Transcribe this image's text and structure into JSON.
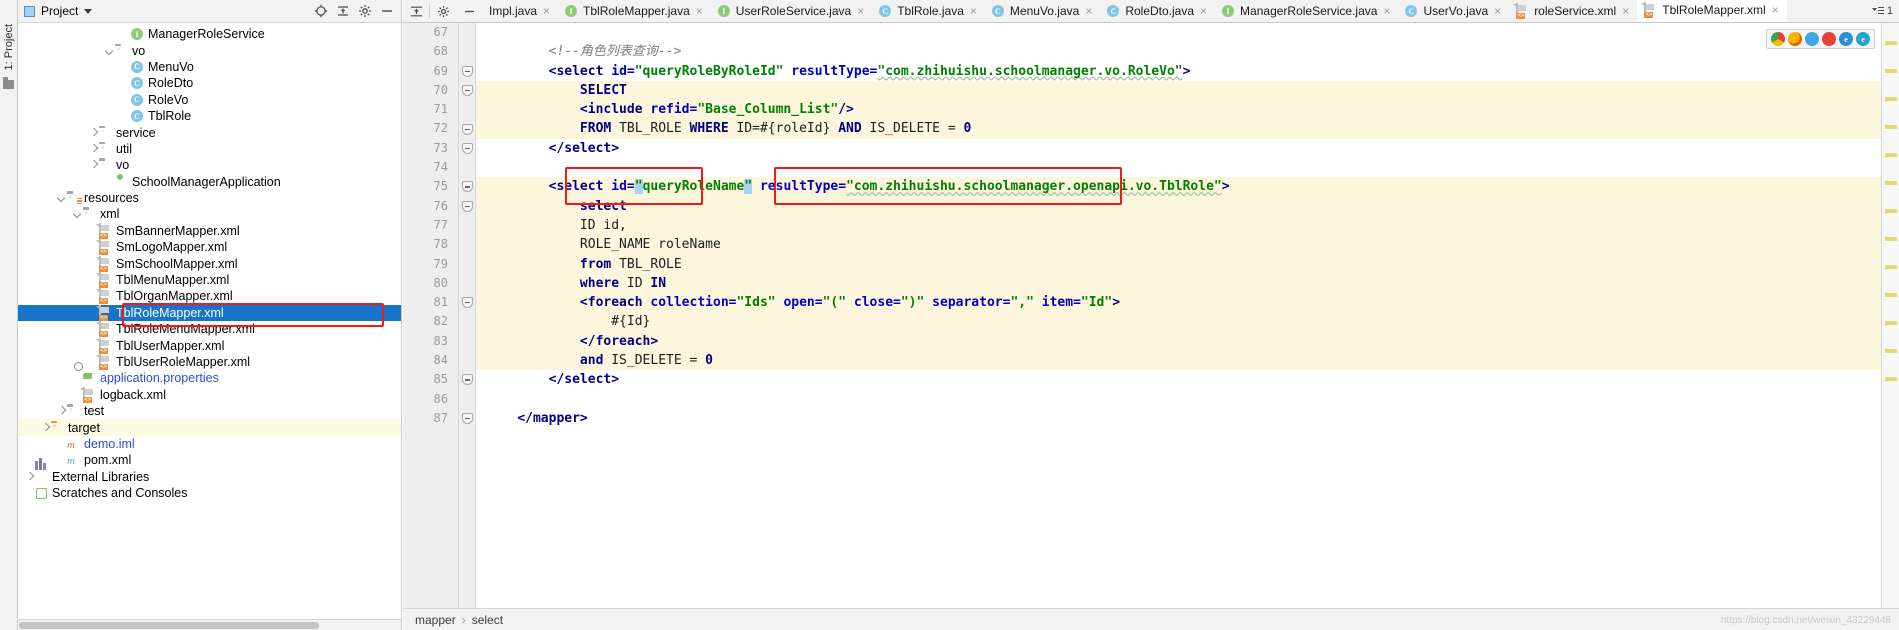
{
  "left_strip": {
    "label": "1: Project",
    "icon": "project-tool-window-icon"
  },
  "project_panel": {
    "title": "Project",
    "header_icons": [
      "locate-icon",
      "expand-collapse-icon",
      "settings-gear-icon",
      "hide-icon"
    ],
    "tree": [
      {
        "indent": 6,
        "arrow": "none",
        "icon": "interface-icon",
        "label": "ManagerRoleService"
      },
      {
        "indent": 5,
        "arrow": "open",
        "icon": "folder-icon",
        "label": "vo"
      },
      {
        "indent": 6,
        "arrow": "none",
        "icon": "class-icon",
        "label": "MenuVo"
      },
      {
        "indent": 6,
        "arrow": "none",
        "icon": "class-icon",
        "label": "RoleDto"
      },
      {
        "indent": 6,
        "arrow": "none",
        "icon": "class-icon",
        "label": "RoleVo"
      },
      {
        "indent": 6,
        "arrow": "none",
        "icon": "class-icon",
        "label": "TblRole"
      },
      {
        "indent": 4,
        "arrow": "closed",
        "icon": "folder-icon",
        "label": "service"
      },
      {
        "indent": 4,
        "arrow": "closed",
        "icon": "folder-icon",
        "label": "util"
      },
      {
        "indent": 4,
        "arrow": "closed",
        "icon": "folder-icon",
        "label": "vo"
      },
      {
        "indent": 5,
        "arrow": "none",
        "icon": "spring-boot-app-icon",
        "label": "SchoolManagerApplication"
      },
      {
        "indent": 2,
        "arrow": "open",
        "icon": "resources-folder-icon",
        "label": "resources"
      },
      {
        "indent": 3,
        "arrow": "open",
        "icon": "folder-icon",
        "label": "xml"
      },
      {
        "indent": 4,
        "arrow": "none",
        "icon": "xml-file-icon",
        "label": "SmBannerMapper.xml"
      },
      {
        "indent": 4,
        "arrow": "none",
        "icon": "xml-file-icon",
        "label": "SmLogoMapper.xml"
      },
      {
        "indent": 4,
        "arrow": "none",
        "icon": "xml-file-icon",
        "label": "SmSchoolMapper.xml"
      },
      {
        "indent": 4,
        "arrow": "none",
        "icon": "xml-file-icon",
        "label": "TblMenuMapper.xml"
      },
      {
        "indent": 4,
        "arrow": "none",
        "icon": "xml-file-icon",
        "label": "TblOrganMapper.xml"
      },
      {
        "indent": 4,
        "arrow": "none",
        "icon": "xml-file-icon",
        "label": "TblRoleMapper.xml",
        "selected": true
      },
      {
        "indent": 4,
        "arrow": "none",
        "icon": "xml-file-icon",
        "label": "TblRoleMenuMapper.xml"
      },
      {
        "indent": 4,
        "arrow": "none",
        "icon": "xml-file-icon",
        "label": "TblUserMapper.xml"
      },
      {
        "indent": 4,
        "arrow": "none",
        "icon": "xml-file-icon",
        "label": "TblUserRoleMapper.xml"
      },
      {
        "indent": 3,
        "arrow": "none",
        "icon": "properties-file-icon",
        "label": "application.properties",
        "link": true
      },
      {
        "indent": 3,
        "arrow": "none",
        "icon": "xml-file-icon",
        "label": "logback.xml"
      },
      {
        "indent": 2,
        "arrow": "closed",
        "icon": "folder-icon",
        "label": "test"
      },
      {
        "indent": 1,
        "arrow": "closed",
        "icon": "folder-orange-icon",
        "label": "target",
        "yellow": true
      },
      {
        "indent": 2,
        "arrow": "none",
        "icon": "iml-file-icon",
        "label": "demo.iml",
        "link": true
      },
      {
        "indent": 2,
        "arrow": "none",
        "icon": "maven-pom-icon",
        "label": "pom.xml"
      },
      {
        "indent": 0,
        "arrow": "closed",
        "icon": "external-libraries-icon",
        "label": "External Libraries"
      },
      {
        "indent": 0,
        "arrow": "none",
        "icon": "scratches-icon",
        "label": "Scratches and Consoles"
      }
    ],
    "annotation_box": "red-highlight-around-TblRoleMapper-xml"
  },
  "editor": {
    "tabs": [
      {
        "label": "Impl.java",
        "icon": "none",
        "active": false,
        "truncated": true
      },
      {
        "label": "TblRoleMapper.java",
        "icon": "interface-icon",
        "active": false
      },
      {
        "label": "UserRoleService.java",
        "icon": "interface-icon",
        "active": false
      },
      {
        "label": "TblRole.java",
        "icon": "class-icon",
        "active": false
      },
      {
        "label": "MenuVo.java",
        "icon": "class-icon",
        "active": false
      },
      {
        "label": "RoleDto.java",
        "icon": "class-icon",
        "active": false
      },
      {
        "label": "ManagerRoleService.java",
        "icon": "interface-icon",
        "active": false
      },
      {
        "label": "UserVo.java",
        "icon": "class-icon",
        "active": false
      },
      {
        "label": "roleService.xml",
        "icon": "xml-file-icon",
        "active": false
      },
      {
        "label": "TblRoleMapper.xml",
        "icon": "xml-file-icon",
        "active": true
      }
    ],
    "tab_close_glyph": "×",
    "tab_overflow_label": "1",
    "gutter_start_line": 67,
    "lines": [
      {
        "n": 67,
        "fold": "none",
        "hl": "none",
        "segs": []
      },
      {
        "n": 68,
        "fold": "none",
        "hl": "none",
        "segs": [
          {
            "t": "comment",
            "s": "        <!--角色列表查询-->"
          }
        ]
      },
      {
        "n": 69,
        "fold": "tip",
        "hl": "block",
        "segs": [
          {
            "t": "plain",
            "s": "        "
          },
          {
            "t": "tag",
            "s": "<select "
          },
          {
            "t": "attr",
            "s": "id="
          },
          {
            "t": "val",
            "s": "\"queryRoleByRoleId\""
          },
          {
            "t": "plain",
            "s": " "
          },
          {
            "t": "attr",
            "s": "resultType="
          },
          {
            "t": "val-wavy",
            "s": "\"com.zhihuishu.schoolmanager.vo.RoleVo\""
          },
          {
            "t": "tag",
            "s": ">"
          }
        ]
      },
      {
        "n": 70,
        "fold": "tip",
        "hl": "yellow",
        "segs": [
          {
            "t": "plain",
            "s": "            "
          },
          {
            "t": "kw",
            "s": "SELECT"
          }
        ]
      },
      {
        "n": 71,
        "fold": "none",
        "hl": "yellow",
        "segs": [
          {
            "t": "plain",
            "s": "            "
          },
          {
            "t": "tag",
            "s": "<include "
          },
          {
            "t": "attr",
            "s": "refid="
          },
          {
            "t": "val",
            "s": "\"Base_Column_List\""
          },
          {
            "t": "tag",
            "s": "/>"
          }
        ]
      },
      {
        "n": 72,
        "fold": "tip",
        "hl": "yellow",
        "segs": [
          {
            "t": "plain",
            "s": "            "
          },
          {
            "t": "kw",
            "s": "FROM "
          },
          {
            "t": "plain",
            "s": "TBL_ROLE "
          },
          {
            "t": "kw",
            "s": "WHERE "
          },
          {
            "t": "plain",
            "s": "ID=#{roleId} "
          },
          {
            "t": "kw",
            "s": "AND "
          },
          {
            "t": "plain",
            "s": "IS_DELETE = "
          },
          {
            "t": "kw",
            "s": "0"
          }
        ]
      },
      {
        "n": 73,
        "fold": "tip",
        "hl": "block",
        "segs": [
          {
            "t": "plain",
            "s": "        "
          },
          {
            "t": "tag",
            "s": "</select>"
          }
        ]
      },
      {
        "n": 74,
        "fold": "none",
        "hl": "none",
        "segs": []
      },
      {
        "n": 75,
        "fold": "tip",
        "hl": "yellow",
        "segs": [
          {
            "t": "plain",
            "s": "        "
          },
          {
            "t": "tag",
            "s": "<select "
          },
          {
            "t": "attr",
            "s": "id="
          },
          {
            "t": "val-sel",
            "s": "\""
          },
          {
            "t": "val",
            "s": "queryRoleName"
          },
          {
            "t": "val-sel",
            "s": "\""
          },
          {
            "t": "plain",
            "s": " "
          },
          {
            "t": "attr",
            "s": "resultType="
          },
          {
            "t": "val-wavy",
            "s": "\"com.zhihuishu.schoolmanager.openapi.vo.TblRole\""
          },
          {
            "t": "tag",
            "s": ">"
          }
        ]
      },
      {
        "n": 76,
        "fold": "tip",
        "hl": "yellow",
        "segs": [
          {
            "t": "plain",
            "s": "            "
          },
          {
            "t": "kw",
            "s": "select"
          }
        ]
      },
      {
        "n": 77,
        "fold": "none",
        "hl": "yellow",
        "segs": [
          {
            "t": "plain",
            "s": "            ID id,"
          }
        ]
      },
      {
        "n": 78,
        "fold": "none",
        "hl": "yellow",
        "segs": [
          {
            "t": "plain",
            "s": "            ROLE_NAME roleName"
          }
        ]
      },
      {
        "n": 79,
        "fold": "none",
        "hl": "yellow",
        "segs": [
          {
            "t": "plain",
            "s": "            "
          },
          {
            "t": "kw",
            "s": "from "
          },
          {
            "t": "plain",
            "s": "TBL_ROLE"
          }
        ]
      },
      {
        "n": 80,
        "fold": "none",
        "hl": "yellow",
        "segs": [
          {
            "t": "plain",
            "s": "            "
          },
          {
            "t": "kw",
            "s": "where "
          },
          {
            "t": "plain",
            "s": "ID "
          },
          {
            "t": "kw",
            "s": "IN"
          }
        ]
      },
      {
        "n": 81,
        "fold": "tip",
        "hl": "yellow",
        "segs": [
          {
            "t": "plain",
            "s": "            "
          },
          {
            "t": "tag",
            "s": "<foreach "
          },
          {
            "t": "attr",
            "s": "collection="
          },
          {
            "t": "val",
            "s": "\"Ids\""
          },
          {
            "t": "plain",
            "s": " "
          },
          {
            "t": "attr",
            "s": "open="
          },
          {
            "t": "val",
            "s": "\"(\""
          },
          {
            "t": "plain",
            "s": " "
          },
          {
            "t": "attr",
            "s": "close="
          },
          {
            "t": "val",
            "s": "\")\""
          },
          {
            "t": "plain",
            "s": " "
          },
          {
            "t": "attr",
            "s": "separator="
          },
          {
            "t": "val",
            "s": "\",\""
          },
          {
            "t": "plain",
            "s": " "
          },
          {
            "t": "attr",
            "s": "item="
          },
          {
            "t": "val",
            "s": "\"Id\""
          },
          {
            "t": "tag",
            "s": ">"
          }
        ]
      },
      {
        "n": 82,
        "fold": "none",
        "hl": "yellow",
        "segs": [
          {
            "t": "plain",
            "s": "                #{Id}"
          }
        ]
      },
      {
        "n": 83,
        "fold": "none",
        "hl": "yellow",
        "segs": [
          {
            "t": "plain",
            "s": "            "
          },
          {
            "t": "tag",
            "s": "</foreach>"
          }
        ]
      },
      {
        "n": 84,
        "fold": "none",
        "hl": "yellow",
        "segs": [
          {
            "t": "plain",
            "s": "            "
          },
          {
            "t": "kw",
            "s": "and "
          },
          {
            "t": "plain",
            "s": "IS_DELETE = "
          },
          {
            "t": "kw",
            "s": "0"
          }
        ]
      },
      {
        "n": 85,
        "fold": "tip",
        "hl": "block",
        "segs": [
          {
            "t": "plain",
            "s": "        "
          },
          {
            "t": "tag",
            "s": "</select>"
          }
        ]
      },
      {
        "n": 86,
        "fold": "none",
        "hl": "none",
        "segs": []
      },
      {
        "n": 87,
        "fold": "tip",
        "hl": "block",
        "segs": [
          {
            "t": "plain",
            "s": "    "
          },
          {
            "t": "tag",
            "s": "</mapper>"
          }
        ]
      }
    ],
    "annotations": [
      {
        "name": "red-box-query-role-name",
        "label": "queryRoleName"
      },
      {
        "name": "red-box-result-type",
        "label": "com.zhihuishu.schoolmanager.openapi.vo.TblRole"
      }
    ],
    "browser_icons": [
      "chrome-icon",
      "firefox-icon",
      "safari-icon",
      "opera-icon",
      "ie-icon",
      "edge-icon"
    ],
    "breadcrumb": [
      "mapper",
      "select"
    ],
    "breadcrumb_separator": "›",
    "watermark": "https://blog.csdn.net/weixin_43229448"
  },
  "colors": {
    "selection_blue": "#1675c8",
    "annotation_red": "#f11a1a",
    "highlight_yellow": "#fdf6dd",
    "tag_navy": "#000080",
    "attr_blue": "#0000c0",
    "value_green": "#008000"
  }
}
